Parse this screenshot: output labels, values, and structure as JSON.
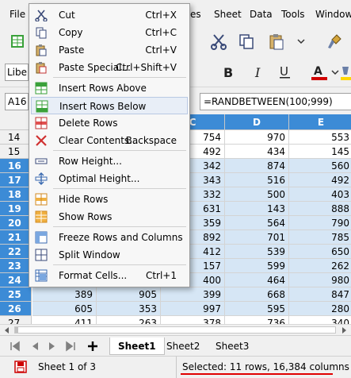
{
  "menubar": {
    "items": [
      "File",
      "es",
      "Sheet",
      "Data",
      "Tools",
      "Window"
    ]
  },
  "toolbar": {
    "font_name": "Libe"
  },
  "formula_bar": {
    "cell_ref": "A16",
    "formula": "=RANDBETWEEN(100;999)"
  },
  "grid": {
    "columns": [
      "C",
      "D",
      "E"
    ],
    "rows": [
      {
        "num": "14",
        "cells": [
          "",
          "754",
          "970",
          "553"
        ],
        "selected": false
      },
      {
        "num": "15",
        "cells": [
          "",
          "492",
          "434",
          "145"
        ],
        "selected": false
      },
      {
        "num": "16",
        "cells": [
          "",
          "342",
          "874",
          "560"
        ],
        "selected": true
      },
      {
        "num": "17",
        "cells": [
          "",
          "343",
          "516",
          "492"
        ],
        "selected": true
      },
      {
        "num": "18",
        "cells": [
          "",
          "332",
          "500",
          "403"
        ],
        "selected": true
      },
      {
        "num": "19",
        "cells": [
          "",
          "631",
          "143",
          "888"
        ],
        "selected": true
      },
      {
        "num": "20",
        "cells": [
          "",
          "359",
          "564",
          "790"
        ],
        "selected": true
      },
      {
        "num": "21",
        "cells": [
          "",
          "892",
          "701",
          "785"
        ],
        "selected": true
      },
      {
        "num": "22",
        "cells": [
          "",
          "412",
          "539",
          "650"
        ],
        "selected": true
      },
      {
        "num": "23",
        "cells": [
          "",
          "157",
          "599",
          "262"
        ],
        "selected": true
      },
      {
        "num": "24",
        "cells": [
          "",
          "400",
          "464",
          "980"
        ],
        "selected": true
      },
      {
        "num": "25",
        "cells": [
          "389",
          "905",
          "399",
          "668",
          "847"
        ],
        "selected": true
      },
      {
        "num": "26",
        "cells": [
          "605",
          "353",
          "997",
          "595",
          "280"
        ],
        "selected": true
      },
      {
        "num": "27",
        "cells": [
          "411",
          "263",
          "378",
          "736",
          "340"
        ],
        "selected": false
      },
      {
        "num": "",
        "cells": [
          "",
          "",
          "",
          "",
          ""
        ],
        "selected": false
      }
    ]
  },
  "sheet_tabs": [
    "Sheet1",
    "Sheet2",
    "Sheet3"
  ],
  "status": {
    "sheet_of": "Sheet 1 of 3",
    "selection": "Selected: 11 rows, 16,384 columns"
  },
  "context_menu": {
    "items": [
      {
        "label": "Cut",
        "shortcut": "Ctrl+X",
        "icon": "scissors-icon"
      },
      {
        "label": "Copy",
        "shortcut": "Ctrl+C",
        "icon": "copy-icon"
      },
      {
        "label": "Paste",
        "shortcut": "Ctrl+V",
        "icon": "paste-icon"
      },
      {
        "label": "Paste Special...",
        "shortcut": "Ctrl+Shift+V",
        "icon": "paste-special-icon"
      },
      {
        "label": "Insert Rows Above",
        "shortcut": "",
        "icon": "insert-rows-above-icon"
      },
      {
        "label": "Insert Rows Below",
        "shortcut": "",
        "icon": "insert-rows-below-icon"
      },
      {
        "label": "Delete Rows",
        "shortcut": "",
        "icon": "delete-rows-icon"
      },
      {
        "label": "Clear Contents...",
        "shortcut": "Backspace",
        "icon": "clear-contents-icon"
      },
      {
        "label": "Row Height...",
        "shortcut": "",
        "icon": "row-height-icon"
      },
      {
        "label": "Optimal Height...",
        "shortcut": "",
        "icon": "optimal-height-icon"
      },
      {
        "label": "Hide Rows",
        "shortcut": "",
        "icon": "hide-rows-icon"
      },
      {
        "label": "Show Rows",
        "shortcut": "",
        "icon": "show-rows-icon"
      },
      {
        "label": "Freeze Rows and Columns",
        "shortcut": "",
        "icon": "freeze-icon"
      },
      {
        "label": "Split Window",
        "shortcut": "",
        "icon": "split-window-icon"
      },
      {
        "label": "Format Cells...",
        "shortcut": "Ctrl+1",
        "icon": "format-cells-icon"
      }
    ]
  },
  "colors": {
    "selection_fill": "#d6e6f5",
    "header_selected": "#3c8bd6",
    "status_underline": "#e00000",
    "font_color_red": "#d00000"
  }
}
